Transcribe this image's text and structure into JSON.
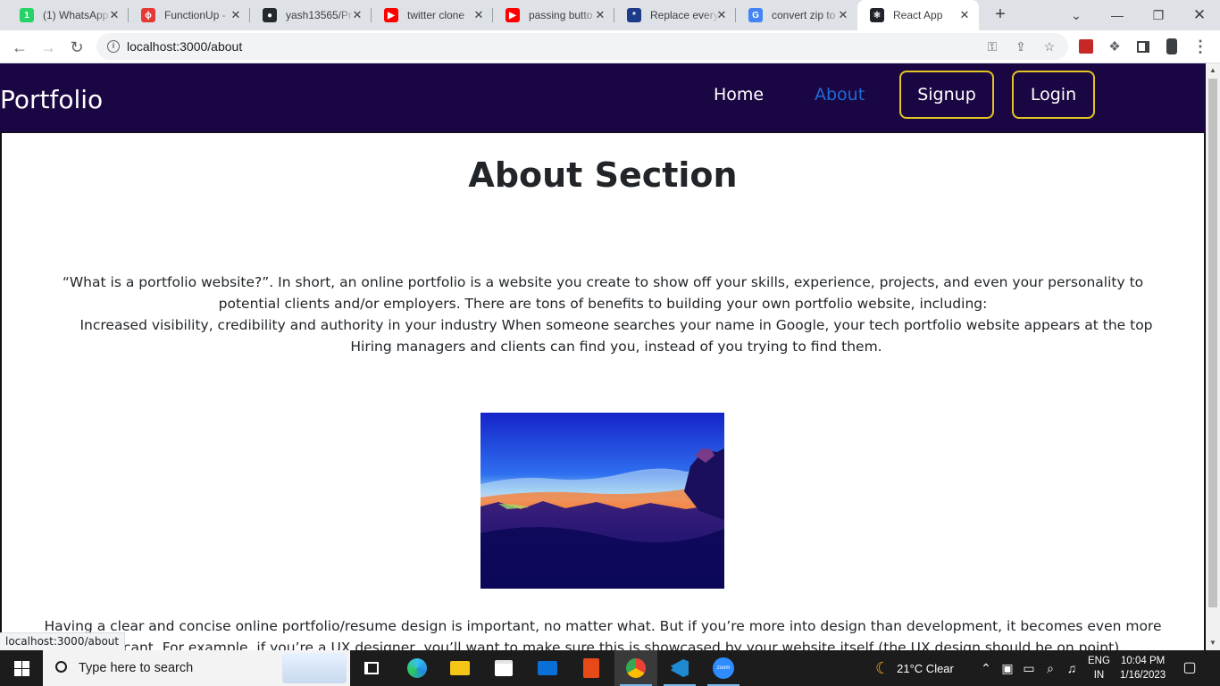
{
  "browser": {
    "tabs": [
      {
        "title": "(1) WhatsApp",
        "icon": "whatsapp-icon",
        "icon_color": "#25d366",
        "icon_glyph": "1"
      },
      {
        "title": "FunctionUp -",
        "icon": "functionup-icon",
        "icon_color": "#e53935",
        "icon_glyph": "ϕ"
      },
      {
        "title": "yash13565/Pr",
        "icon": "github-icon",
        "icon_color": "#24292f",
        "icon_glyph": "●"
      },
      {
        "title": "twitter clone",
        "icon": "youtube-icon",
        "icon_color": "#ff0000",
        "icon_glyph": "▶"
      },
      {
        "title": "passing butto",
        "icon": "youtube-icon",
        "icon_color": "#ff0000",
        "icon_glyph": "▶"
      },
      {
        "title": "Replace every",
        "icon": "regex-icon",
        "icon_color": "#1e3a8a",
        "icon_glyph": "*"
      },
      {
        "title": "convert zip to",
        "icon": "google-icon",
        "icon_color": "#4285f4",
        "icon_glyph": "G"
      },
      {
        "title": "React App",
        "icon": "react-icon",
        "icon_color": "#20232a",
        "icon_glyph": "⚛"
      }
    ],
    "active_tab_index": 7,
    "url": "localhost:3000/about",
    "status_url": "localhost:3000/about"
  },
  "site": {
    "brand": "Portfolio",
    "nav": {
      "home": "Home",
      "about": "About",
      "signup": "Signup",
      "login": "Login"
    },
    "colors": {
      "navbar_bg": "#1b0644",
      "active_link": "#1e6bd6",
      "button_border": "#e2c522"
    }
  },
  "about": {
    "title": "About Section",
    "para1_line1": "“What is a portfolio website?”. In short, an online portfolio is a website you create to show off your skills, experience, projects, and even your personality to",
    "para1_line2": "potential clients and/or employers. There are tons of benefits to building your own portfolio website, including:",
    "para1_line3": "Increased visibility, credibility and authority in your industry When someone searches your name in Google, your tech portfolio website appears at the top",
    "para1_line4": "Hiring managers and clients can find you, instead of you trying to find them.",
    "para2_line1": "Having a clear and concise online portfolio/resume design is important, no matter what. But if you’re more into design than development, it becomes even more",
    "para2_line2": "significant. For example, if you’re a UX designer, you’ll want to make sure this is showcased by your website itself (the UX design should be on point)."
  },
  "taskbar": {
    "search_placeholder": "Type here to search",
    "weather": "21°C  Clear",
    "language_top": "ENG",
    "language_bottom": "IN",
    "time": "10:04 PM",
    "date": "1/16/2023"
  }
}
